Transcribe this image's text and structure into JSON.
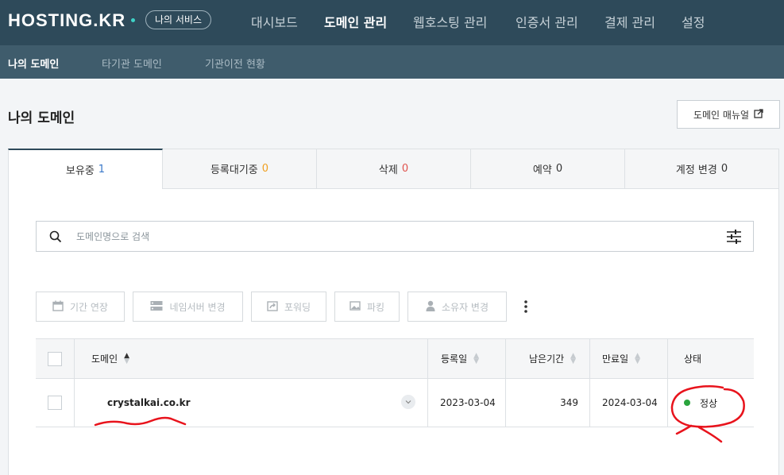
{
  "header": {
    "logo": "HOSTING.KR",
    "service_pill": "나의 서비스",
    "nav": [
      {
        "label": "대시보드"
      },
      {
        "label": "도메인 관리"
      },
      {
        "label": "웹호스팅 관리"
      },
      {
        "label": "인증서 관리"
      },
      {
        "label": "결제 관리"
      },
      {
        "label": "설정"
      }
    ],
    "active_nav": "도메인 관리"
  },
  "subnav": {
    "items": [
      {
        "label": "나의 도메인"
      },
      {
        "label": "타기관 도메인"
      },
      {
        "label": "기관이전 현황"
      }
    ],
    "active": "나의 도메인"
  },
  "page": {
    "title": "나의 도메인",
    "manual_button": "도메인 매뉴얼"
  },
  "tabs": [
    {
      "label": "보유중",
      "count": "1",
      "count_color": "#3a78c9"
    },
    {
      "label": "등록대기중",
      "count": "0",
      "count_color": "#f0a020"
    },
    {
      "label": "삭제",
      "count": "0",
      "count_color": "#e0544e"
    },
    {
      "label": "예약",
      "count": "0",
      "count_color": "#333333"
    },
    {
      "label": "계정 변경",
      "count": "0",
      "count_color": "#333333"
    }
  ],
  "search": {
    "placeholder": "도메인명으로 검색",
    "value": ""
  },
  "actions": [
    {
      "label": "기간 연장",
      "icon": "calendar-icon"
    },
    {
      "label": "네임서버 변경",
      "icon": "server-icon"
    },
    {
      "label": "포워딩",
      "icon": "forward-icon"
    },
    {
      "label": "파킹",
      "icon": "image-icon"
    },
    {
      "label": "소유자 변경",
      "icon": "person-icon"
    }
  ],
  "table": {
    "columns": [
      "도메인",
      "등록일",
      "남은기간",
      "만료일",
      "상태"
    ],
    "rows": [
      {
        "domain": "crystalkai.co.kr",
        "registered": "2023-03-04",
        "remaining": "349",
        "expires": "2024-03-04",
        "status": "정상",
        "status_color": "#2aa43d"
      }
    ]
  },
  "colors": {
    "topbar": "#2e4a5a",
    "subbar": "#3f5c6c",
    "logo_accent": "#3fd2c7",
    "annotation_red": "#e8131c"
  }
}
